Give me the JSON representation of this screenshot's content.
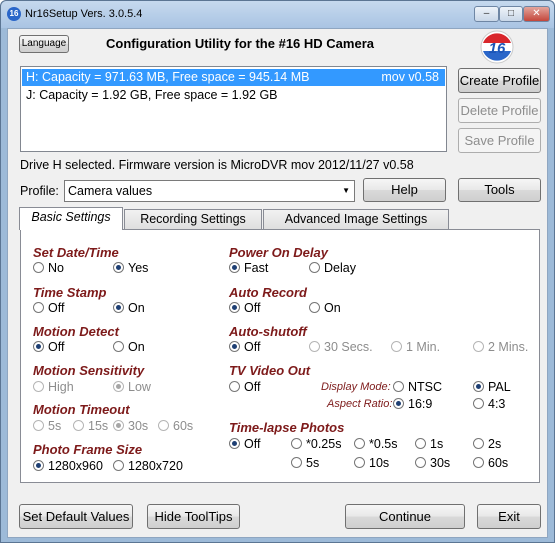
{
  "window": {
    "title": "Nr16Setup  Vers. 3.0.5.4",
    "app_icon_text": "16"
  },
  "header": {
    "language_button": "Language",
    "title": "Configuration Utility for the #16 HD Camera",
    "logo_text": "16"
  },
  "drives": [
    {
      "label": "H:  Capacity = 971.63 MB, Free space = 945.14 MB",
      "version": "mov v0.58"
    },
    {
      "label": "J:  Capacity = 1.92 GB, Free space = 1.92 GB",
      "version": ""
    }
  ],
  "side_buttons": {
    "create": "Create Profile",
    "delete": "Delete Profile",
    "save": "Save Profile"
  },
  "status": "Drive H selected. Firmware version is MicroDVR mov 2012/11/27 v0.58",
  "profile": {
    "label": "Profile:",
    "value": "Camera values",
    "help": "Help",
    "tools": "Tools"
  },
  "tabs": [
    "Basic Settings",
    "Recording Settings",
    "Advanced Image Settings"
  ],
  "basic": {
    "set_date_time": {
      "title": "Set Date/Time",
      "options": [
        "No",
        "Yes"
      ],
      "selected": "Yes"
    },
    "time_stamp": {
      "title": "Time Stamp",
      "options": [
        "Off",
        "On"
      ],
      "selected": "On"
    },
    "motion_detect": {
      "title": "Motion Detect",
      "options": [
        "Off",
        "On"
      ],
      "selected": "Off"
    },
    "motion_sensitivity": {
      "title": "Motion Sensitivity",
      "options": [
        "High",
        "Low"
      ],
      "selected": "Low"
    },
    "motion_timeout": {
      "title": "Motion Timeout",
      "options": [
        "5s",
        "15s",
        "30s",
        "60s"
      ],
      "selected": "30s"
    },
    "photo_frame_size": {
      "title": "Photo Frame Size",
      "options": [
        "1280x960",
        "1280x720"
      ],
      "selected": "1280x960"
    },
    "power_on_delay": {
      "title": "Power On Delay",
      "options": [
        "Fast",
        "Delay"
      ],
      "selected": "Fast"
    },
    "auto_record": {
      "title": "Auto Record",
      "options": [
        "Off",
        "On"
      ],
      "selected": "Off"
    },
    "auto_shutoff": {
      "title": "Auto-shutoff",
      "options": [
        "Off",
        "30 Secs.",
        "1 Min.",
        "2 Mins."
      ],
      "selected": "Off"
    },
    "tv_video_out": {
      "title": "TV Video Out",
      "option": "Off",
      "display_mode_label": "Display Mode:",
      "display_modes": [
        "NTSC",
        "PAL"
      ],
      "display_selected": "PAL",
      "aspect_label": "Aspect Ratio:",
      "aspects": [
        "16:9",
        "4:3"
      ],
      "aspect_selected": "16:9"
    },
    "timelapse": {
      "title": "Time-lapse Photos",
      "options": [
        "Off",
        "*0.25s",
        "*0.5s",
        "1s",
        "2s",
        "5s",
        "10s",
        "30s",
        "60s"
      ],
      "selected": "Off"
    }
  },
  "footer": {
    "defaults": "Set Default Values",
    "tooltips": "Hide ToolTips",
    "continue": "Continue",
    "exit": "Exit"
  }
}
